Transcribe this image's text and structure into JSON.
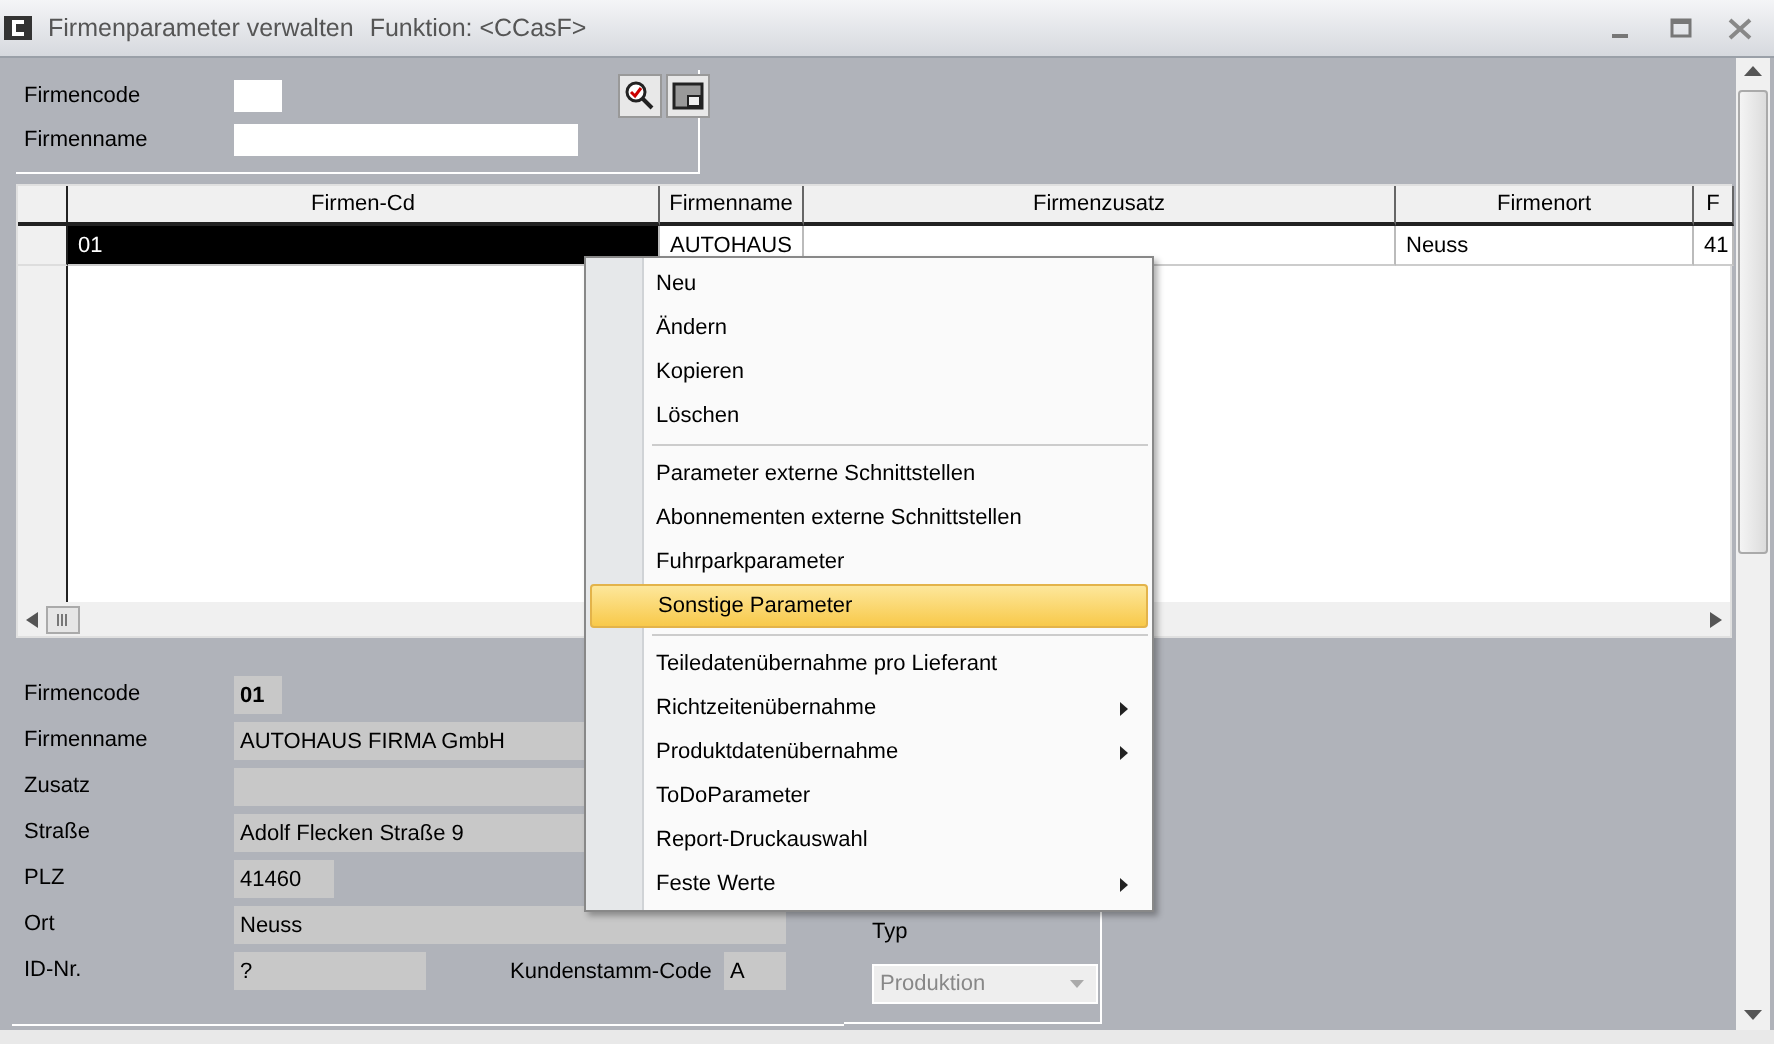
{
  "window": {
    "title": "Firmenparameter verwalten",
    "function": "Funktion: <CCasF>"
  },
  "filter": {
    "fields": [
      {
        "label": "Firmencode"
      },
      {
        "label": "Firmenname"
      }
    ]
  },
  "table": {
    "columns": [
      "Firmen-Cd",
      "Firmenname",
      "Firmenzusatz",
      "Firmenort",
      "F"
    ],
    "rows": [
      {
        "cells": [
          "01",
          "AUTOHAUS",
          "",
          "Neuss",
          "41"
        ],
        "selected": true
      }
    ]
  },
  "details": {
    "fields": [
      {
        "label": "Firmencode",
        "value": "01",
        "kind": "code"
      },
      {
        "label": "Firmenname",
        "value": "AUTOHAUS FIRMA GmbH",
        "kind": "wide"
      },
      {
        "label": "Zusatz",
        "kind": "wide"
      },
      {
        "label": "Straße",
        "value": "Adolf Flecken Straße 9",
        "kind": "wide"
      },
      {
        "label": "PLZ",
        "value": "41460",
        "kind": "short"
      },
      {
        "label": "Ort",
        "value": "Neuss",
        "kind": "wide"
      },
      {
        "label": "ID-Nr.",
        "value": "?",
        "kind": "medium"
      }
    ],
    "kundenstamm": {
      "label": "Kundenstamm-Code",
      "value": "A"
    },
    "typ": {
      "label": "Typ",
      "value": "Produktion",
      "disabled": true
    }
  },
  "context_menu": {
    "groups": [
      [
        {
          "label": "Neu",
          "selected": false,
          "submenu": false
        },
        {
          "label": "Ändern",
          "selected": false,
          "submenu": false
        },
        {
          "label": "Kopieren",
          "selected": false,
          "submenu": false
        },
        {
          "label": "Löschen",
          "selected": false,
          "submenu": false
        }
      ],
      [
        {
          "label": "Parameter externe Schnittstellen",
          "selected": false,
          "submenu": false
        },
        {
          "label": "Abonnementen externe Schnittstellen",
          "selected": false,
          "submenu": false
        },
        {
          "label": "Fuhrparkparameter",
          "selected": false,
          "submenu": false
        },
        {
          "label": "Sonstige Parameter",
          "selected": true,
          "submenu": false
        }
      ],
      [
        {
          "label": "Teiledatenübernahme pro Lieferant",
          "selected": false,
          "submenu": false
        },
        {
          "label": "Richtzeitenübernahme",
          "selected": false,
          "submenu": true
        },
        {
          "label": "Produktdatenübernahme",
          "selected": false,
          "submenu": true
        },
        {
          "label": "ToDoParameter",
          "selected": false,
          "submenu": false
        },
        {
          "label": "Report-Druckauswahl",
          "selected": false,
          "submenu": false
        },
        {
          "label": "Feste Werte",
          "selected": false,
          "submenu": true
        }
      ]
    ]
  }
}
